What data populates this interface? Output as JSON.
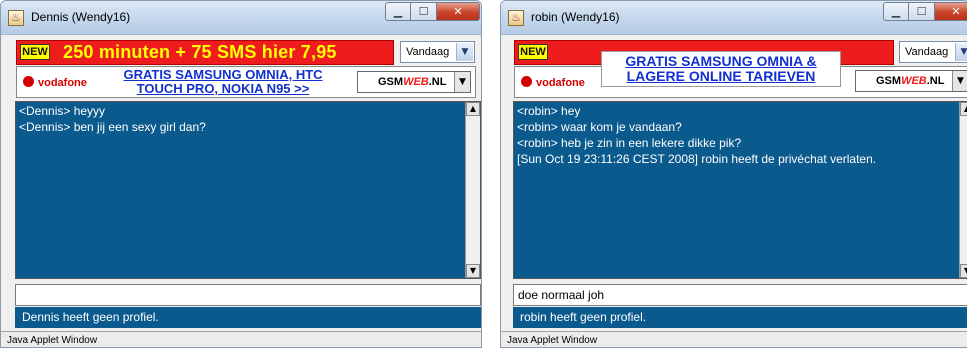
{
  "windows": [
    {
      "title": "Dennis (Wendy16)",
      "ad": {
        "badge": "NEW",
        "headline": "250 minuten + 75 SMS hier 7,95",
        "operator": "vodafone",
        "promo_line1": "GRATIS SAMSUNG OMNIA, HTC",
        "promo_line2": "TOUCH PRO, NOKIA N95 >>",
        "brand_prefix": "GSM",
        "brand_web": "WEB",
        "brand_suffix": ".NL"
      },
      "dropdown": {
        "value": "Vandaag"
      },
      "messages": [
        "<Dennis> heyyy",
        "<Dennis> ben jij een sexy girl dan?"
      ],
      "input_value": "",
      "status": "Dennis heeft geen profiel.",
      "footer": "Java Applet Window"
    },
    {
      "title": "robin (Wendy16)",
      "ad": {
        "badge": "NEW",
        "headline": "",
        "operator": "vodafone",
        "promo_line1": "GRATIS SAMSUNG OMNIA &",
        "promo_line2": "LAGERE  ONLINE TARIEVEN",
        "brand_prefix": "GSM",
        "brand_web": "WEB",
        "brand_suffix": ".NL"
      },
      "dropdown": {
        "value": "Vandaag"
      },
      "messages": [
        "<robin> hey",
        "<robin> waar kom je vandaan?",
        "<robin> heb je zin in een lekere dikke pik?",
        "[Sun Oct 19 23:11:26 CEST 2008] robin heeft de privéchat verlaten."
      ],
      "input_value": "doe normaal joh",
      "status": "robin heeft geen profiel.",
      "footer": "Java Applet Window"
    }
  ]
}
